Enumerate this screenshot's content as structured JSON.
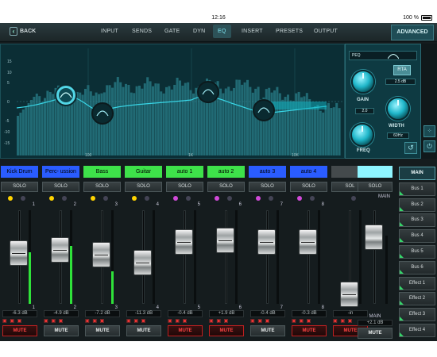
{
  "status_bar": {
    "time": "12:16",
    "battery": "100 %"
  },
  "nav": {
    "back_label": "BACK",
    "tabs": [
      {
        "label": "INPUT",
        "active": false
      },
      {
        "label": "SENDS",
        "active": false
      },
      {
        "label": "GATE",
        "active": false
      },
      {
        "label": "DYN",
        "active": false
      },
      {
        "label": "EQ",
        "active": true
      },
      {
        "label": "INSERT",
        "active": false
      },
      {
        "label": "PRESETS",
        "active": false
      },
      {
        "label": "OUTPUT",
        "active": false
      }
    ],
    "advanced_label": "ADVANCED"
  },
  "eq": {
    "y_ticks": [
      "15",
      "10",
      "5",
      "0",
      "-5",
      "-10",
      "-15"
    ],
    "x_ticks": [
      "100",
      "1K",
      "10K"
    ],
    "band_type": "PEQ",
    "rta_label": "RTA",
    "gain_label": "GAIN",
    "gain_value": "2.5 dB",
    "width_label": "WIDTH",
    "width_value": "2.0",
    "freq_label": "FREQ",
    "freq_value": "60Hz",
    "accent_color": "#1fb6c9"
  },
  "channels": [
    {
      "name": "Kick Drum",
      "color": "#2a5cff",
      "num": "1",
      "db": "-6.3 dB",
      "mute": "MUTE",
      "mute_on": true,
      "fader": 0.62,
      "meter": 0.55,
      "ind": "yellow"
    },
    {
      "name": "Perc- ussion",
      "color": "#2a5cff",
      "num": "2",
      "db": "-4.9 dB",
      "mute": "MUTE",
      "mute_on": false,
      "fader": 0.66,
      "meter": 0.62,
      "ind": "yellow"
    },
    {
      "name": "Bass",
      "color": "#3ee24a",
      "num": "3",
      "db": "-7.2 dB",
      "mute": "MUTE",
      "mute_on": false,
      "fader": 0.6,
      "meter": 0.35,
      "ind": "yellow"
    },
    {
      "name": "Guitar",
      "color": "#3ee24a",
      "num": "4",
      "db": "-11.3 dB",
      "mute": "MUTE",
      "mute_on": false,
      "fader": 0.5,
      "meter": 0.0,
      "ind": "yellow"
    },
    {
      "name": "auto 1",
      "color": "#3ee24a",
      "num": "5",
      "db": "-0.4 dB",
      "mute": "MUTE",
      "mute_on": true,
      "fader": 0.76,
      "meter": 0.0,
      "ind": "pink"
    },
    {
      "name": "auto 2",
      "color": "#3ee24a",
      "num": "6",
      "db": "+1.9 dB",
      "mute": "MUTE",
      "mute_on": true,
      "fader": 0.78,
      "meter": 0.0,
      "ind": "pink"
    },
    {
      "name": "auto 3",
      "color": "#2a5cff",
      "num": "7",
      "db": "-0.4 dB",
      "mute": "MUTE",
      "mute_on": false,
      "fader": 0.76,
      "meter": 0.0,
      "ind": "pink"
    },
    {
      "name": "auto 4",
      "color": "#2a5cff",
      "num": "8",
      "db": "-0.3 dB",
      "mute": "MUTE",
      "mute_on": true,
      "fader": 0.76,
      "meter": 0.0,
      "ind": "pink"
    },
    {
      "name": "",
      "color": "#444a4c",
      "num": "",
      "db": "-in",
      "mute": "MUTE",
      "mute_on": true,
      "fader": 0.1,
      "meter": 0.0,
      "ind": "none",
      "solo": "SOL"
    }
  ],
  "main_strip": {
    "name_color": "#8ff5ff",
    "solo": "SOLO",
    "label": "MAIN",
    "bottom_label": "MAIN",
    "db": "+2.1 dB",
    "mute": "MUTE",
    "fader": 0.82
  },
  "buses": [
    {
      "label": "MAIN",
      "active": true
    },
    {
      "label": "Bus 1",
      "active": false
    },
    {
      "label": "Bus 2",
      "active": false
    },
    {
      "label": "Bus 3",
      "active": false
    },
    {
      "label": "Bus 4",
      "active": false
    },
    {
      "label": "Bus 5",
      "active": false
    },
    {
      "label": "Bus 6",
      "active": false
    },
    {
      "label": "Effect 1",
      "active": false
    },
    {
      "label": "Effect 2",
      "active": false
    },
    {
      "label": "Effect 3",
      "active": false
    },
    {
      "label": "Effect 4",
      "active": false
    }
  ]
}
